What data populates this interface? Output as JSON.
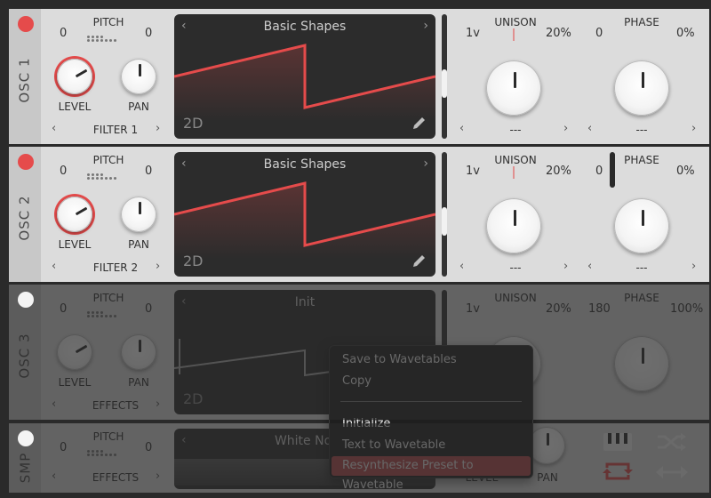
{
  "colors": {
    "accent": "#e54b4b",
    "panel": "#dcdcdc",
    "wavetable_bg": "#2c2c2c",
    "menu_bg": "#1f1f1f",
    "menu_highlight": "#b5494c"
  },
  "oscillators": [
    {
      "label": "OSC 1",
      "enabled": true,
      "pitch_label": "PITCH",
      "pitch_left": "0",
      "pitch_right": "0",
      "level_label": "LEVEL",
      "pan_label": "PAN",
      "destination": "FILTER 1",
      "wavetable_name": "Basic Shapes",
      "view_mode": "2D",
      "unison_label": "UNISON",
      "unison_voices": "1v",
      "unison_detune": "20%",
      "unison_select": "---",
      "phase_label": "PHASE",
      "phase_value": "0",
      "phase_random": "0%",
      "phase_select": "---"
    },
    {
      "label": "OSC 2",
      "enabled": true,
      "pitch_label": "PITCH",
      "pitch_left": "0",
      "pitch_right": "0",
      "level_label": "LEVEL",
      "pan_label": "PAN",
      "destination": "FILTER 2",
      "wavetable_name": "Basic Shapes",
      "view_mode": "2D",
      "unison_label": "UNISON",
      "unison_voices": "1v",
      "unison_detune": "20%",
      "unison_select": "---",
      "phase_label": "PHASE",
      "phase_value": "0",
      "phase_random": "0%",
      "phase_select": "---"
    },
    {
      "label": "OSC 3",
      "enabled": false,
      "pitch_label": "PITCH",
      "pitch_left": "0",
      "pitch_right": "0",
      "level_label": "LEVEL",
      "pan_label": "PAN",
      "destination": "EFFECTS",
      "wavetable_name": "Init",
      "view_mode": "2D",
      "unison_label": "UNISON",
      "unison_voices": "1v",
      "unison_detune": "20%",
      "phase_label": "PHASE",
      "phase_value": "180",
      "phase_random": "100%"
    }
  ],
  "sampler": {
    "label": "SMP",
    "enabled": false,
    "pitch_label": "PITCH",
    "pitch_left": "0",
    "pitch_right": "0",
    "destination": "EFFECTS",
    "sample_name": "White Noi",
    "level_label": "LEVEL",
    "pan_label": "PAN"
  },
  "context_menu": {
    "items": [
      {
        "label": "Save to Wavetables"
      },
      {
        "label": "Copy"
      },
      {
        "label": "Initialize"
      },
      {
        "label": "Text to Wavetable"
      },
      {
        "label": "Resynthesize Preset to Wavetable"
      }
    ]
  }
}
